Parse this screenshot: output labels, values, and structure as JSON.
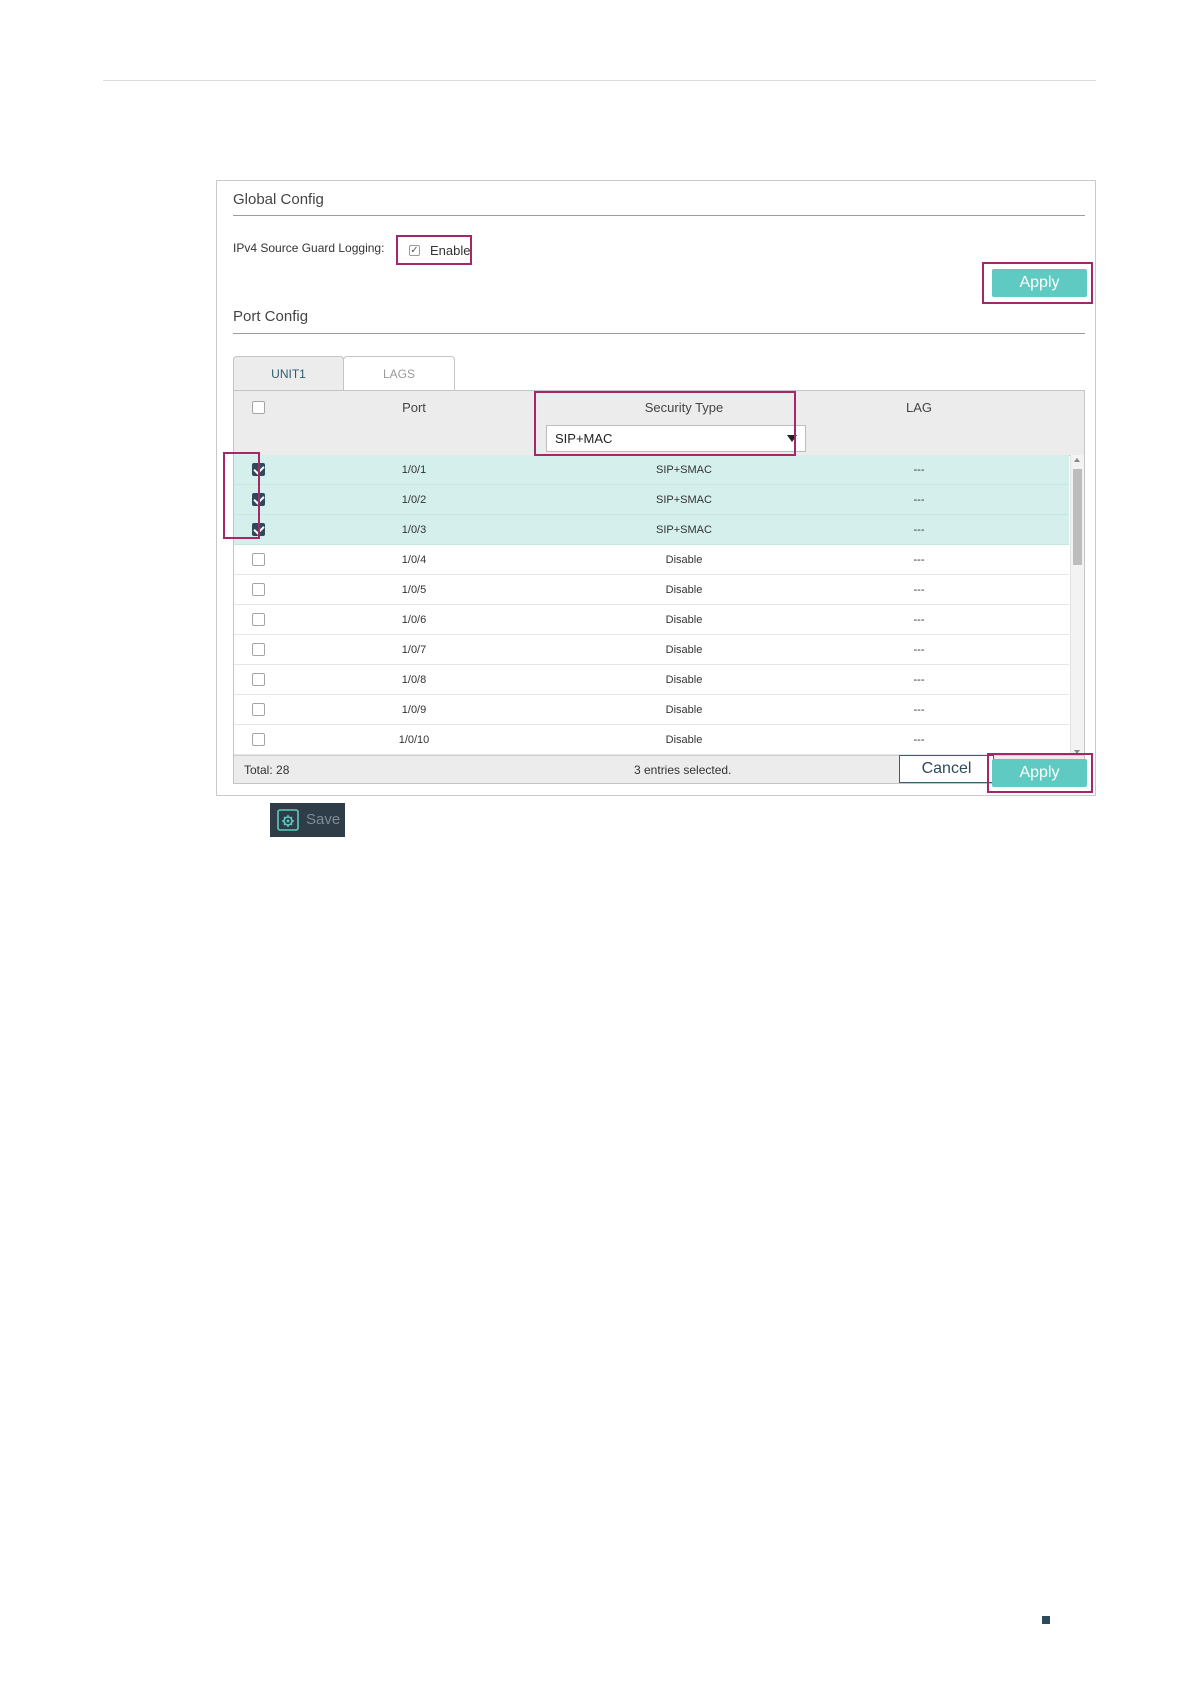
{
  "global_config": {
    "title": "Global Config",
    "logging_label": "IPv4 Source Guard Logging:",
    "enable_label": "Enable",
    "enable_checked": true,
    "apply_label": "Apply"
  },
  "port_config": {
    "title": "Port Config",
    "tabs": [
      {
        "label": "UNIT1",
        "active": true
      },
      {
        "label": "LAGS",
        "active": false
      }
    ],
    "columns": {
      "port": "Port",
      "security_type": "Security Type",
      "lag": "LAG"
    },
    "security_type_filter": "SIP+MAC",
    "rows": [
      {
        "selected": true,
        "port": "1/0/1",
        "security_type": "SIP+SMAC",
        "lag": "---"
      },
      {
        "selected": true,
        "port": "1/0/2",
        "security_type": "SIP+SMAC",
        "lag": "---"
      },
      {
        "selected": true,
        "port": "1/0/3",
        "security_type": "SIP+SMAC",
        "lag": "---"
      },
      {
        "selected": false,
        "port": "1/0/4",
        "security_type": "Disable",
        "lag": "---"
      },
      {
        "selected": false,
        "port": "1/0/5",
        "security_type": "Disable",
        "lag": "---"
      },
      {
        "selected": false,
        "port": "1/0/6",
        "security_type": "Disable",
        "lag": "---"
      },
      {
        "selected": false,
        "port": "1/0/7",
        "security_type": "Disable",
        "lag": "---"
      },
      {
        "selected": false,
        "port": "1/0/8",
        "security_type": "Disable",
        "lag": "---"
      },
      {
        "selected": false,
        "port": "1/0/9",
        "security_type": "Disable",
        "lag": "---"
      },
      {
        "selected": false,
        "port": "1/0/10",
        "security_type": "Disable",
        "lag": "---"
      }
    ],
    "total": "Total: 28",
    "selection_status": "3 entries selected.",
    "cancel_label": "Cancel",
    "apply_label": "Apply"
  },
  "save_label": "Save",
  "colors": {
    "accent": "#5fcac2",
    "highlight": "#a3286a",
    "selected_row": "#d5efec",
    "dark": "#2c4a5c"
  }
}
